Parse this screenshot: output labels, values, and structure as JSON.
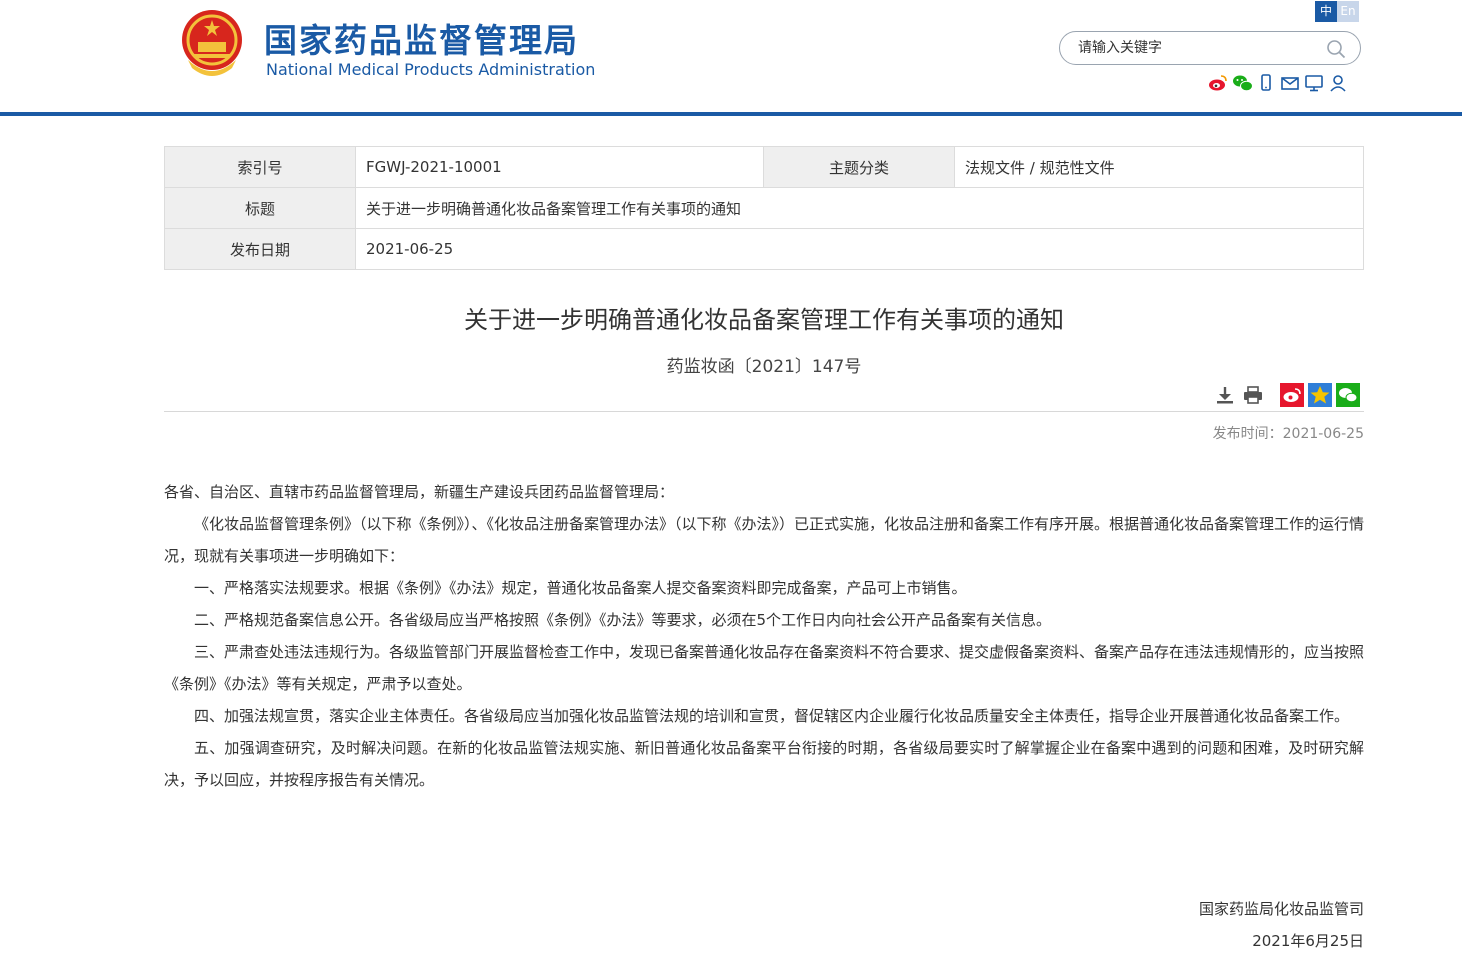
{
  "header": {
    "site_title": "国家药品监督管理局",
    "site_subtitle": "National Medical Products Administration",
    "lang_zh": "中",
    "lang_en": "En",
    "search_placeholder": "请输入关键字",
    "social_icons": [
      "weibo-icon",
      "wechat-icon",
      "mobile-icon",
      "mail-icon",
      "monitor-icon",
      "user-icon"
    ]
  },
  "colors": {
    "brand_blue": "#1a5aa5",
    "label_bg": "#efefef",
    "weibo": "#e6162d",
    "wechat": "#1aad19"
  },
  "info": {
    "index_label": "索引号",
    "index_value": "FGWJ-2021-10001",
    "topic_label": "主题分类",
    "topic_value": "法规文件 / 规范性文件",
    "title_label": "标题",
    "title_value": "关于进一步明确普通化妆品备案管理工作有关事项的通知",
    "date_label": "发布日期",
    "date_value": "2021-06-25"
  },
  "article": {
    "title": "关于进一步明确普通化妆品备案管理工作有关事项的通知",
    "doc_number": "药监妆函〔2021〕147号",
    "publish_time": "发布时间：2021-06-25",
    "salutation": "各省、自治区、直辖市药品监督管理局，新疆生产建设兵团药品监督管理局：",
    "paragraphs": [
      "《化妆品监督管理条例》（以下称《条例》）、《化妆品注册备案管理办法》（以下称《办法》）已正式实施，化妆品注册和备案工作有序开展。根据普通化妆品备案管理工作的运行情况，现就有关事项进一步明确如下：",
      "一、严格落实法规要求。根据《条例》《办法》规定，普通化妆品备案人提交备案资料即完成备案，产品可上市销售。",
      "二、严格规范备案信息公开。各省级局应当严格按照《条例》《办法》等要求，必须在5个工作日内向社会公开产品备案有关信息。",
      "三、严肃查处违法违规行为。各级监管部门开展监督检查工作中，发现已备案普通化妆品存在备案资料不符合要求、提交虚假备案资料、备案产品存在违法违规情形的，应当按照《条例》《办法》等有关规定，严肃予以查处。",
      "四、加强法规宣贯，落实企业主体责任。各省级局应当加强化妆品监管法规的培训和宣贯，督促辖区内企业履行化妆品质量安全主体责任，指导企业开展普通化妆品备案工作。",
      "五、加强调查研究，及时解决问题。在新的化妆品监管法规实施、新旧普通化妆品备案平台衔接的时期，各省级局要实时了解掌握企业在备案中遇到的问题和困难，及时研究解决，予以回应，并按程序报告有关情况。"
    ],
    "signature": "国家药监局化妆品监管司",
    "sign_date": "2021年6月25日"
  }
}
